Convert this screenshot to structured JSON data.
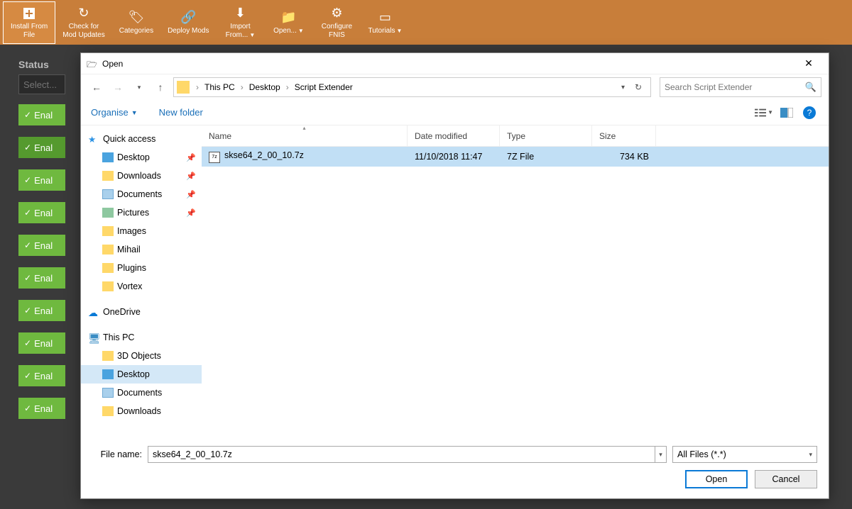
{
  "toolbar": {
    "install": "Install From\nFile",
    "updates": "Check for\nMod Updates",
    "categories": "Categories",
    "deploy": "Deploy Mods",
    "import": "Import\nFrom...",
    "open": "Open...",
    "fnis": "Configure\nFNIS",
    "tutorials": "Tutorials"
  },
  "sidebar": {
    "status_header": "Status",
    "select_placeholder": "Select...",
    "enable_label": "Enal"
  },
  "dialog": {
    "title": "Open",
    "breadcrumb": {
      "pc": "This PC",
      "desktop": "Desktop",
      "folder": "Script Extender"
    },
    "search_placeholder": "Search Script Extender",
    "organise": "Organise",
    "new_folder": "New folder",
    "columns": {
      "name": "Name",
      "date": "Date modified",
      "type": "Type",
      "size": "Size"
    },
    "file": {
      "name": "skse64_2_00_10.7z",
      "date": "11/10/2018 11:47",
      "type": "7Z File",
      "size": "734 KB"
    },
    "tree": {
      "quick": "Quick access",
      "desktop": "Desktop",
      "downloads": "Downloads",
      "documents": "Documents",
      "pictures": "Pictures",
      "images": "Images",
      "mihail": "Mihail",
      "plugins": "Plugins",
      "vortex": "Vortex",
      "onedrive": "OneDrive",
      "thispc": "This PC",
      "objects3d": "3D Objects",
      "desktop2": "Desktop",
      "documents2": "Documents",
      "downloads2": "Downloads"
    },
    "filename_label": "File name:",
    "filename_value": "skse64_2_00_10.7z",
    "filter": "All Files (*.*)",
    "open_btn": "Open",
    "cancel_btn": "Cancel"
  }
}
